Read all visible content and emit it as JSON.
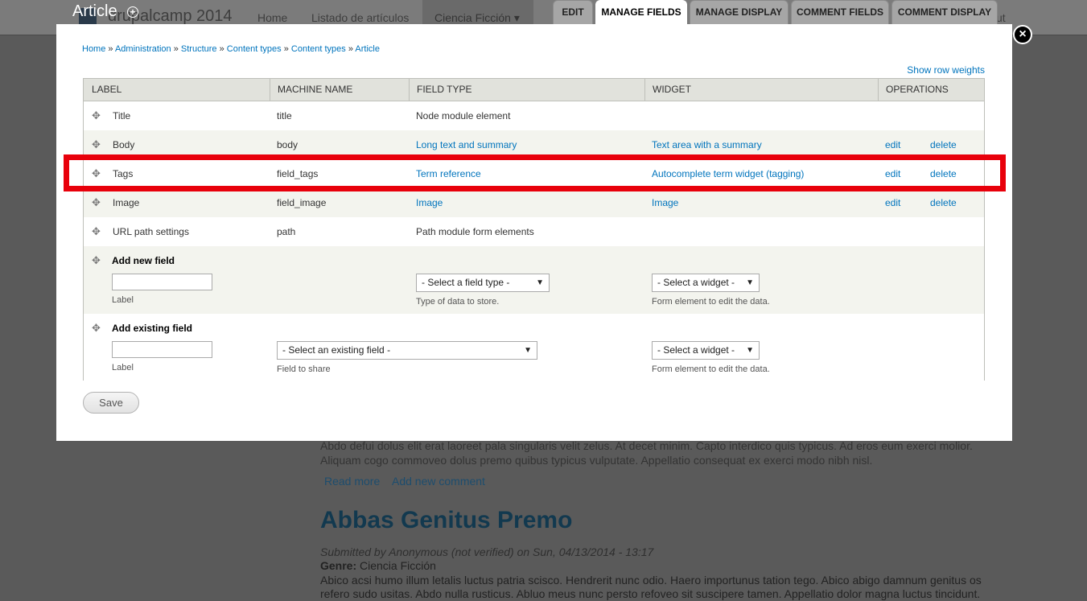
{
  "background": {
    "site_name": "drupalcamp 2014",
    "nav": [
      "Home",
      "Listado de artículos",
      "Ciencia Ficción ▾"
    ],
    "user_menu_fragment": "ut",
    "teaser_text_1": "Abdo defui dolus elit erat laoreet pala singularis velit zelus. At decet minim. Capto interdico quis typicus. Ad eros eum exerci molior.",
    "teaser_text_2": "Aliquam cogo commoveo dolus premo quibus typicus vulputate. Appellatio consequat ex exerci modo nibh nisl.",
    "read_more": "Read more",
    "add_comment": "Add new comment",
    "article_title": "Abbas Genitus Premo",
    "submitted": "Submitted by Anonymous (not verified) on Sun, 04/13/2014 - 13:17",
    "genre_label": "Genre:",
    "genre_value": " Ciencia Ficción",
    "body_text_1": "Abico acsi humo illum letalis luctus patria scisco. Hendrerit nunc odio. Haero importunus tation tego. Abico abigo damnum genitus os",
    "body_text_2": "refero sudo usitas. Abdo nulla rusticus. Abluo meus nunc persto refoveo sit suscipere tamen. Appellatio dolor magna luctus tincidunt."
  },
  "overlay": {
    "title": "Article",
    "shortcut_icon": "+",
    "close_icon": "×",
    "tabs": [
      "EDIT",
      "MANAGE FIELDS",
      "MANAGE DISPLAY",
      "COMMENT FIELDS",
      "COMMENT DISPLAY"
    ],
    "active_tab": "MANAGE FIELDS"
  },
  "breadcrumb": [
    "Home",
    "Administration",
    "Structure",
    "Content types",
    "Content types",
    "Article"
  ],
  "breadcrumb_separator": " » ",
  "show_row_weights": "Show row weights",
  "table": {
    "headers": [
      "LABEL",
      "MACHINE NAME",
      "FIELD TYPE",
      "WIDGET",
      "OPERATIONS"
    ],
    "rows": [
      {
        "label": "Title",
        "machine": "title",
        "type": "Node module element",
        "widget": "",
        "edit": "",
        "delete": ""
      },
      {
        "label": "Body",
        "machine": "body",
        "type": "Long text and summary",
        "widget": "Text area with a summary",
        "edit": "edit",
        "delete": "delete"
      },
      {
        "label": "Tags",
        "machine": "field_tags",
        "type": "Term reference",
        "widget": "Autocomplete term widget (tagging)",
        "edit": "edit",
        "delete": "delete"
      },
      {
        "label": "Image",
        "machine": "field_image",
        "type": "Image",
        "widget": "Image",
        "edit": "edit",
        "delete": "delete"
      },
      {
        "label": "URL path settings",
        "machine": "path",
        "type": "Path module form elements",
        "widget": "",
        "edit": "",
        "delete": ""
      }
    ],
    "add_new": {
      "title": "Add new field",
      "label_value": "",
      "label_desc": "Label",
      "type_select": "- Select a field type -",
      "type_desc": "Type of data to store.",
      "widget_select": "- Select a widget -",
      "widget_desc": "Form element to edit the data."
    },
    "add_existing": {
      "title": "Add existing field",
      "label_value": "",
      "label_desc": "Label",
      "field_select": "- Select an existing field -",
      "field_desc": "Field to share",
      "widget_select": "- Select a widget -",
      "widget_desc": "Form element to edit the data."
    }
  },
  "save_label": "Save",
  "colors": {
    "link": "#0074bd",
    "highlight": "#e8000b"
  }
}
